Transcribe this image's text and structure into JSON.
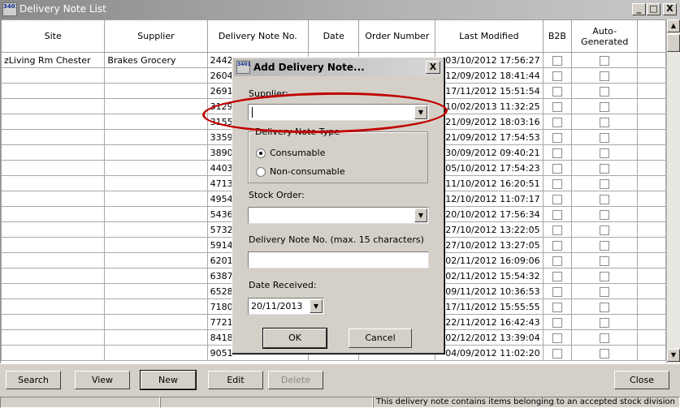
{
  "window": {
    "title": "Delivery Note List",
    "icon_text": "3401",
    "minimize": "_",
    "maximize": "□",
    "close": "X"
  },
  "grid": {
    "columns": [
      "Site",
      "Supplier",
      "Delivery Note No.",
      "Date",
      "Order Number",
      "Last Modified",
      "B2B",
      "Auto-Generated"
    ],
    "rows": [
      {
        "site": "zLiving Rm Chester",
        "supplier": "Brakes Grocery",
        "note": "2442",
        "date": "",
        "order": "",
        "modified": "03/10/2012 17:56:27"
      },
      {
        "site": "",
        "supplier": "",
        "note": "2604",
        "date": "",
        "order": "",
        "modified": "12/09/2012 18:41:44"
      },
      {
        "site": "",
        "supplier": "",
        "note": "2691",
        "date": "",
        "order": "",
        "modified": "17/11/2012 15:51:54"
      },
      {
        "site": "",
        "supplier": "",
        "note": "3129",
        "date": "",
        "order": "",
        "modified": "10/02/2013 11:32:25"
      },
      {
        "site": "",
        "supplier": "",
        "note": "3155",
        "date": "",
        "order": "",
        "modified": "21/09/2012 18:03:16"
      },
      {
        "site": "",
        "supplier": "",
        "note": "3359",
        "date": "",
        "order": "",
        "modified": "21/09/2012 17:54:53"
      },
      {
        "site": "",
        "supplier": "",
        "note": "3890",
        "date": "",
        "order": "",
        "modified": "30/09/2012 09:40:21"
      },
      {
        "site": "",
        "supplier": "",
        "note": "4403",
        "date": "",
        "order": "",
        "modified": "05/10/2012 17:54:23"
      },
      {
        "site": "",
        "supplier": "",
        "note": "4713",
        "date": "",
        "order": "",
        "modified": "11/10/2012 16:20:51"
      },
      {
        "site": "",
        "supplier": "",
        "note": "4954",
        "date": "",
        "order": "",
        "modified": "12/10/2012 11:07:17"
      },
      {
        "site": "",
        "supplier": "",
        "note": "5436",
        "date": "",
        "order": "",
        "modified": "20/10/2012 17:56:34"
      },
      {
        "site": "",
        "supplier": "",
        "note": "5732",
        "date": "",
        "order": "",
        "modified": "27/10/2012 13:22:05"
      },
      {
        "site": "",
        "supplier": "",
        "note": "5914",
        "date": "",
        "order": "",
        "modified": "27/10/2012 13:27:05"
      },
      {
        "site": "",
        "supplier": "",
        "note": "6201",
        "date": "",
        "order": "",
        "modified": "02/11/2012 16:09:06"
      },
      {
        "site": "",
        "supplier": "",
        "note": "6387",
        "date": "",
        "order": "",
        "modified": "02/11/2012 15:54:32"
      },
      {
        "site": "",
        "supplier": "",
        "note": "6528",
        "date": "",
        "order": "",
        "modified": "09/11/2012 10:36:53"
      },
      {
        "site": "",
        "supplier": "",
        "note": "7180",
        "date": "",
        "order": "",
        "modified": "17/11/2012 15:55:55"
      },
      {
        "site": "",
        "supplier": "",
        "note": "7721",
        "date": "",
        "order": "",
        "modified": "22/11/2012 16:42:43"
      },
      {
        "site": "",
        "supplier": "",
        "note": "8418",
        "date": "",
        "order": "",
        "modified": "02/12/2012 13:39:04"
      },
      {
        "site": "",
        "supplier": "",
        "note": "9051",
        "date": "",
        "order": "",
        "modified": "04/09/2012 11:02:20"
      }
    ]
  },
  "buttons": {
    "search": "Search",
    "view": "View",
    "new": "New",
    "edit": "Edit",
    "delete": "Delete",
    "close": "Close"
  },
  "status": {
    "message": "This delivery note contains items belonging to an accepted stock division"
  },
  "dialog": {
    "title": "Add Delivery Note...",
    "icon_text": "3401",
    "close": "X",
    "supplier_label": "Supplier:",
    "supplier_value": "",
    "note_type_label": "Delivery Note Type",
    "type_consumable": "Consumable",
    "type_nonconsumable": "Non-consumable",
    "selected_type": "Consumable",
    "stock_order_label": "Stock Order:",
    "stock_order_value": "",
    "note_no_label": "Delivery Note No. (max. 15 characters)",
    "note_no_value": "",
    "date_label": "Date Received:",
    "date_value": "20/11/2013",
    "ok": "OK",
    "cancel": "Cancel"
  },
  "annotation": {
    "color": "#c00000"
  },
  "icons": {
    "dropdown": "▼",
    "scroll_up": "▲",
    "scroll_down": "▼"
  }
}
